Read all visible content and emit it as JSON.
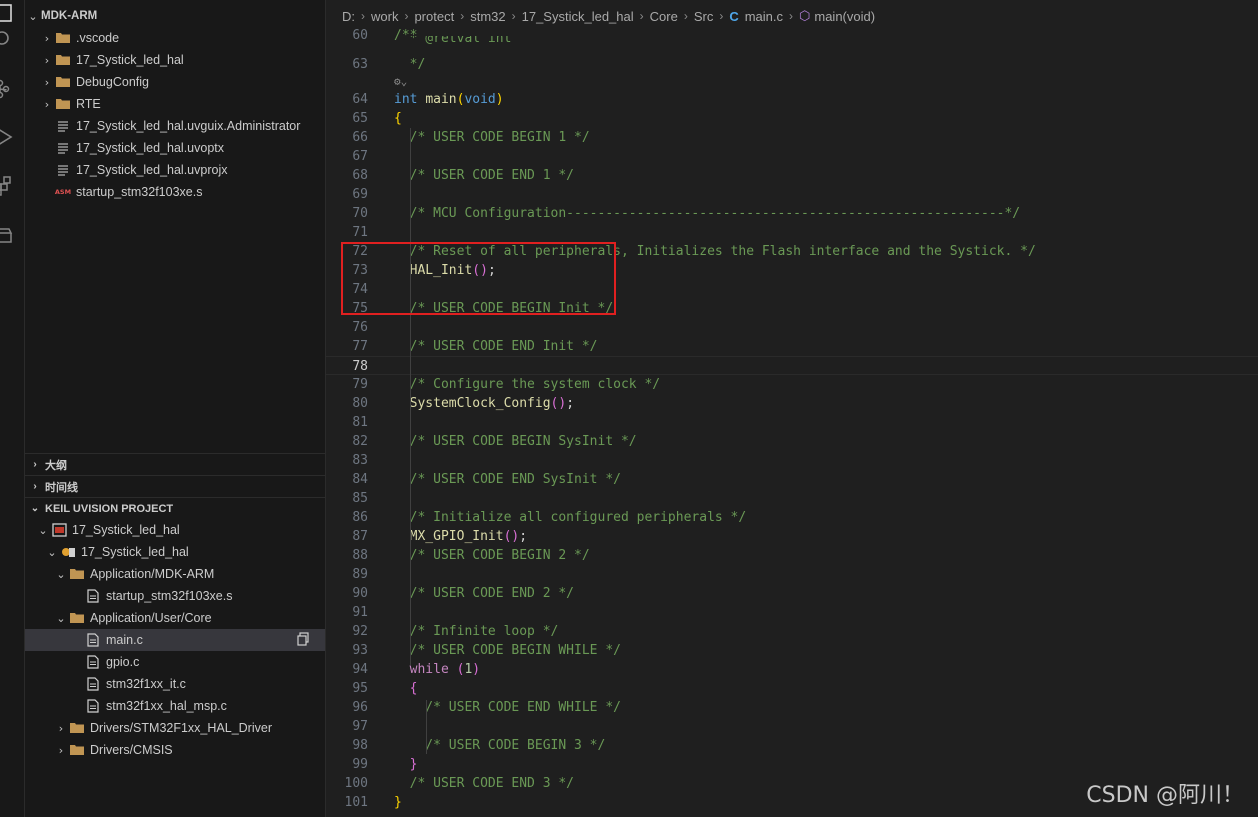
{
  "breadcrumb": {
    "items": [
      "D:",
      "work",
      "protect",
      "stm32",
      "17_Systick_led_hal",
      "Core",
      "Src"
    ],
    "file_icon": "C",
    "file": "main.c",
    "symbol": "main(void)"
  },
  "explorer": {
    "root": "MDK-ARM",
    "items": [
      {
        "label": ".vscode",
        "type": "folder"
      },
      {
        "label": "17_Systick_led_hal",
        "type": "folder"
      },
      {
        "label": "DebugConfig",
        "type": "folder"
      },
      {
        "label": "RTE",
        "type": "folder"
      },
      {
        "label": "17_Systick_led_hal.uvguix.Administrator",
        "type": "file"
      },
      {
        "label": "17_Systick_led_hal.uvoptx",
        "type": "file"
      },
      {
        "label": "17_Systick_led_hal.uvprojx",
        "type": "file"
      },
      {
        "label": "startup_stm32f103xe.s",
        "type": "asm",
        "badge": "ASM"
      }
    ]
  },
  "outline": {
    "label": "大纲"
  },
  "timeline": {
    "label": "时间线"
  },
  "keil": {
    "header": "KEIL UVISION PROJECT",
    "project": "17_Systick_led_hal",
    "target": "17_Systick_led_hal",
    "groups": [
      {
        "label": "Application/MDK-ARM",
        "files": [
          "startup_stm32f103xe.s"
        ]
      },
      {
        "label": "Application/User/Core",
        "files": [
          "main.c",
          "gpio.c",
          "stm32f1xx_it.c",
          "stm32f1xx_hal_msp.c"
        ]
      },
      {
        "label": "Drivers/STM32F1xx_HAL_Driver",
        "files": []
      },
      {
        "label": "Drivers/CMSIS",
        "files": []
      }
    ],
    "selected_file": "main.c"
  },
  "editor": {
    "current_line": "78",
    "codelens_icon": "codelens-icon",
    "sticky": [
      {
        "num": "60",
        "text": "/**"
      },
      {
        "num": "62",
        "text": "  * @retval int"
      },
      {
        "num": "63",
        "text": "  */"
      }
    ],
    "lines": [
      {
        "num": "64",
        "segs": [
          [
            "kw",
            "int"
          ],
          [
            "plain",
            " "
          ],
          [
            "fn",
            "main"
          ],
          [
            "br1",
            "("
          ],
          [
            "kw",
            "void"
          ],
          [
            "br1",
            ")"
          ]
        ]
      },
      {
        "num": "65",
        "segs": [
          [
            "br1",
            "{"
          ]
        ]
      },
      {
        "num": "66",
        "segs": [
          [
            "cm",
            "  /* USER CODE BEGIN 1 */"
          ]
        ]
      },
      {
        "num": "67",
        "segs": []
      },
      {
        "num": "68",
        "segs": [
          [
            "cm",
            "  /* USER CODE END 1 */"
          ]
        ]
      },
      {
        "num": "69",
        "segs": []
      },
      {
        "num": "70",
        "segs": [
          [
            "cm",
            "  /* MCU Configuration--------------------------------------------------------*/"
          ]
        ]
      },
      {
        "num": "71",
        "segs": []
      },
      {
        "num": "72",
        "segs": [
          [
            "cm",
            "  /* Reset of all peripherals, Initializes the Flash interface and the Systick. */"
          ]
        ]
      },
      {
        "num": "73",
        "segs": [
          [
            "plain",
            "  "
          ],
          [
            "fn",
            "HAL_Init"
          ],
          [
            "br2",
            "()"
          ],
          [
            "plain",
            ";"
          ]
        ]
      },
      {
        "num": "74",
        "segs": []
      },
      {
        "num": "75",
        "segs": [
          [
            "cm",
            "  /* USER CODE BEGIN Init */"
          ]
        ]
      },
      {
        "num": "76",
        "segs": []
      },
      {
        "num": "77",
        "segs": [
          [
            "cm",
            "  /* USER CODE END Init */"
          ]
        ]
      },
      {
        "num": "78",
        "segs": []
      },
      {
        "num": "79",
        "segs": [
          [
            "cm",
            "  /* Configure the system clock */"
          ]
        ]
      },
      {
        "num": "80",
        "segs": [
          [
            "plain",
            "  "
          ],
          [
            "fn",
            "SystemClock_Config"
          ],
          [
            "br2",
            "()"
          ],
          [
            "plain",
            ";"
          ]
        ]
      },
      {
        "num": "81",
        "segs": []
      },
      {
        "num": "82",
        "segs": [
          [
            "cm",
            "  /* USER CODE BEGIN SysInit */"
          ]
        ]
      },
      {
        "num": "83",
        "segs": []
      },
      {
        "num": "84",
        "segs": [
          [
            "cm",
            "  /* USER CODE END SysInit */"
          ]
        ]
      },
      {
        "num": "85",
        "segs": []
      },
      {
        "num": "86",
        "segs": [
          [
            "cm",
            "  /* Initialize all configured peripherals */"
          ]
        ]
      },
      {
        "num": "87",
        "segs": [
          [
            "plain",
            "  "
          ],
          [
            "fn",
            "MX_GPIO_Init"
          ],
          [
            "br2",
            "()"
          ],
          [
            "plain",
            ";"
          ]
        ]
      },
      {
        "num": "88",
        "segs": [
          [
            "cm",
            "  /* USER CODE BEGIN 2 */"
          ]
        ]
      },
      {
        "num": "89",
        "segs": []
      },
      {
        "num": "90",
        "segs": [
          [
            "cm",
            "  /* USER CODE END 2 */"
          ]
        ]
      },
      {
        "num": "91",
        "segs": []
      },
      {
        "num": "92",
        "segs": [
          [
            "cm",
            "  /* Infinite loop */"
          ]
        ]
      },
      {
        "num": "93",
        "segs": [
          [
            "cm",
            "  /* USER CODE BEGIN WHILE */"
          ]
        ]
      },
      {
        "num": "94",
        "segs": [
          [
            "plain",
            "  "
          ],
          [
            "ctl",
            "while"
          ],
          [
            "plain",
            " "
          ],
          [
            "br2",
            "("
          ],
          [
            "num",
            "1"
          ],
          [
            "br2",
            ")"
          ]
        ]
      },
      {
        "num": "95",
        "segs": [
          [
            "plain",
            "  "
          ],
          [
            "br2",
            "{"
          ]
        ]
      },
      {
        "num": "96",
        "segs": [
          [
            "cm",
            "    /* USER CODE END WHILE */"
          ]
        ]
      },
      {
        "num": "97",
        "segs": []
      },
      {
        "num": "98",
        "segs": [
          [
            "cm",
            "    /* USER CODE BEGIN 3 */"
          ]
        ]
      },
      {
        "num": "99",
        "segs": [
          [
            "plain",
            "  "
          ],
          [
            "br2",
            "}"
          ]
        ]
      },
      {
        "num": "100",
        "segs": [
          [
            "cm",
            "  /* USER CODE END 3 */"
          ]
        ]
      },
      {
        "num": "101",
        "segs": [
          [
            "br1",
            "}"
          ]
        ]
      }
    ]
  },
  "watermark": "CSDN @阿川！",
  "colors": {
    "accent": "#4fa6e8",
    "highlight_box": "#e02020",
    "comment": "#6a9955",
    "keyword": "#569cd6",
    "function": "#dcdcaa"
  }
}
